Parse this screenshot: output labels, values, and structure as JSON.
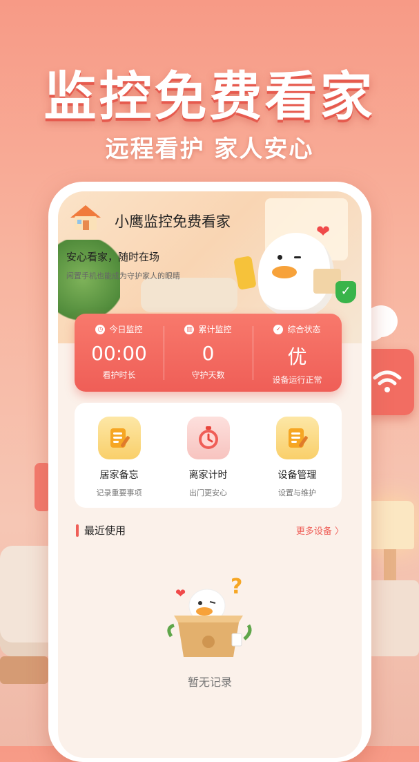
{
  "poster": {
    "headline": "监控免费看家",
    "subline": "远程看护  家人安心"
  },
  "app": {
    "title": "小鹰监控免费看家",
    "tagline": "安心看家，随时在场",
    "tagline_small": "闲置手机也能成为守护家人的眼睛"
  },
  "stats": [
    {
      "icon": "clock-icon",
      "label": "今日监控",
      "value": "00:00",
      "sub": "看护时长"
    },
    {
      "icon": "bar-chart-icon",
      "label": "累计监控",
      "value": "0",
      "sub": "守护天数"
    },
    {
      "icon": "shield-icon",
      "label": "综合状态",
      "value": "优",
      "sub": "设备运行正常"
    }
  ],
  "tools": [
    {
      "icon": "notepad-icon",
      "name": "居家备忘",
      "desc": "记录重要事项"
    },
    {
      "icon": "stopwatch-icon",
      "name": "离家计时",
      "desc": "出门更安心"
    },
    {
      "icon": "notepad-edit-icon",
      "name": "设备管理",
      "desc": "设置与维护"
    }
  ],
  "recent": {
    "title": "最近使用",
    "more": "更多设备 〉",
    "empty": "暂无记录"
  },
  "colors": {
    "accent": "#ef5e57",
    "background": "#f8b49f"
  }
}
